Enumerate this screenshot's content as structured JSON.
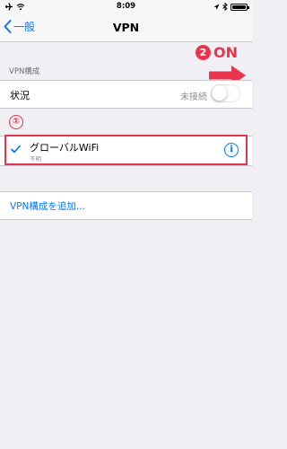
{
  "status_bar": {
    "time": "8:09",
    "left_icons": [
      "airplane-icon",
      "wifi-icon"
    ],
    "right_icons": [
      "location-icon",
      "bluetooth-icon",
      "battery-icon"
    ],
    "battery_level": 1.0
  },
  "nav": {
    "back_label": "一般",
    "title": "VPN"
  },
  "section": {
    "header": "VPN構成"
  },
  "status_row": {
    "label": "状況",
    "value": "未接続",
    "toggle_on": false
  },
  "vpn_config": {
    "name": "グローバルWiFi",
    "subtitle": "不明",
    "selected": true
  },
  "add_config": {
    "label": "VPN構成を追加..."
  },
  "annotations": {
    "step1": "①",
    "step2_num": "2",
    "step2_label": "ON",
    "color": "#e8344e"
  },
  "colors": {
    "accent": "#007aff",
    "background": "#efeff4",
    "secondary_text": "#8e8e93"
  }
}
